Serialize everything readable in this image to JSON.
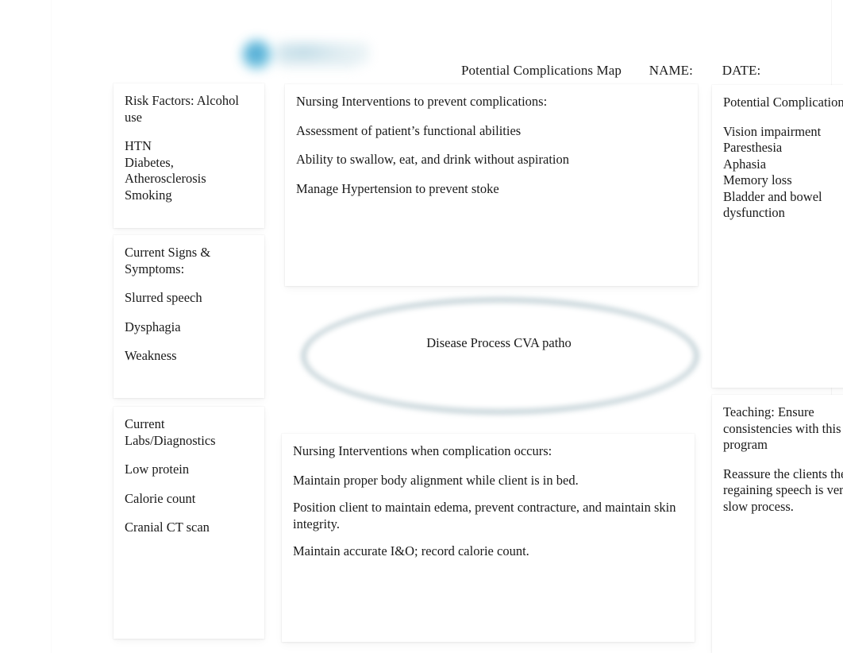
{
  "document": {
    "header": {
      "title": "Potential Complications Map",
      "name_label": "NAME:",
      "date_label": "DATE:"
    },
    "logo": {
      "mark": "logo-circle-icon",
      "wordmark": "blurred-wordmark"
    },
    "center_node": {
      "label": "Disease Process CVA patho"
    },
    "boxes": {
      "risk_factors": {
        "title": "Risk Factors: Alcohol use",
        "items": [
          "HTN",
          "Diabetes,",
          "Atherosclerosis",
          "Smoking"
        ]
      },
      "signs_symptoms": {
        "title": "Current Signs & Symptoms:",
        "items": [
          "Slurred speech",
          "Dysphagia",
          "Weakness"
        ]
      },
      "labs_diagnostics": {
        "title": "Current Labs/Diagnostics",
        "items": [
          "Low protein",
          "Calorie count",
          "Cranial CT scan"
        ]
      },
      "interventions_prevent": {
        "title": "Nursing Interventions to prevent complications:",
        "items": [
          "Assessment of patient’s functional abilities",
          "Ability to swallow, eat, and drink without aspiration",
          "Manage Hypertension to prevent stoke"
        ]
      },
      "interventions_occurs": {
        "title": "Nursing Interventions when complication occurs:",
        "items": [
          "Maintain proper body alignment while client is in bed.",
          "Position client to maintain edema, prevent contracture, and maintain skin integrity.",
          "Maintain accurate I&O; record calorie count."
        ]
      },
      "potential_complications": {
        "title": "Potential Complications:",
        "items": [
          "Vision impairment",
          "Paresthesia",
          "Aphasia",
          "Memory loss",
          "Bladder and bowel dysfunction"
        ]
      },
      "teaching": {
        "title": "Teaching: Ensure consistencies with this program",
        "items": [
          "Reassure the clients the regaining speech is very slow process."
        ]
      }
    },
    "colors": {
      "page_background": "#ffffff",
      "text": "#1a1a1a",
      "oval_border": "#c5d3d8",
      "logo_blue": "#2a93c9",
      "logo_word": "#cfe4ec"
    }
  }
}
